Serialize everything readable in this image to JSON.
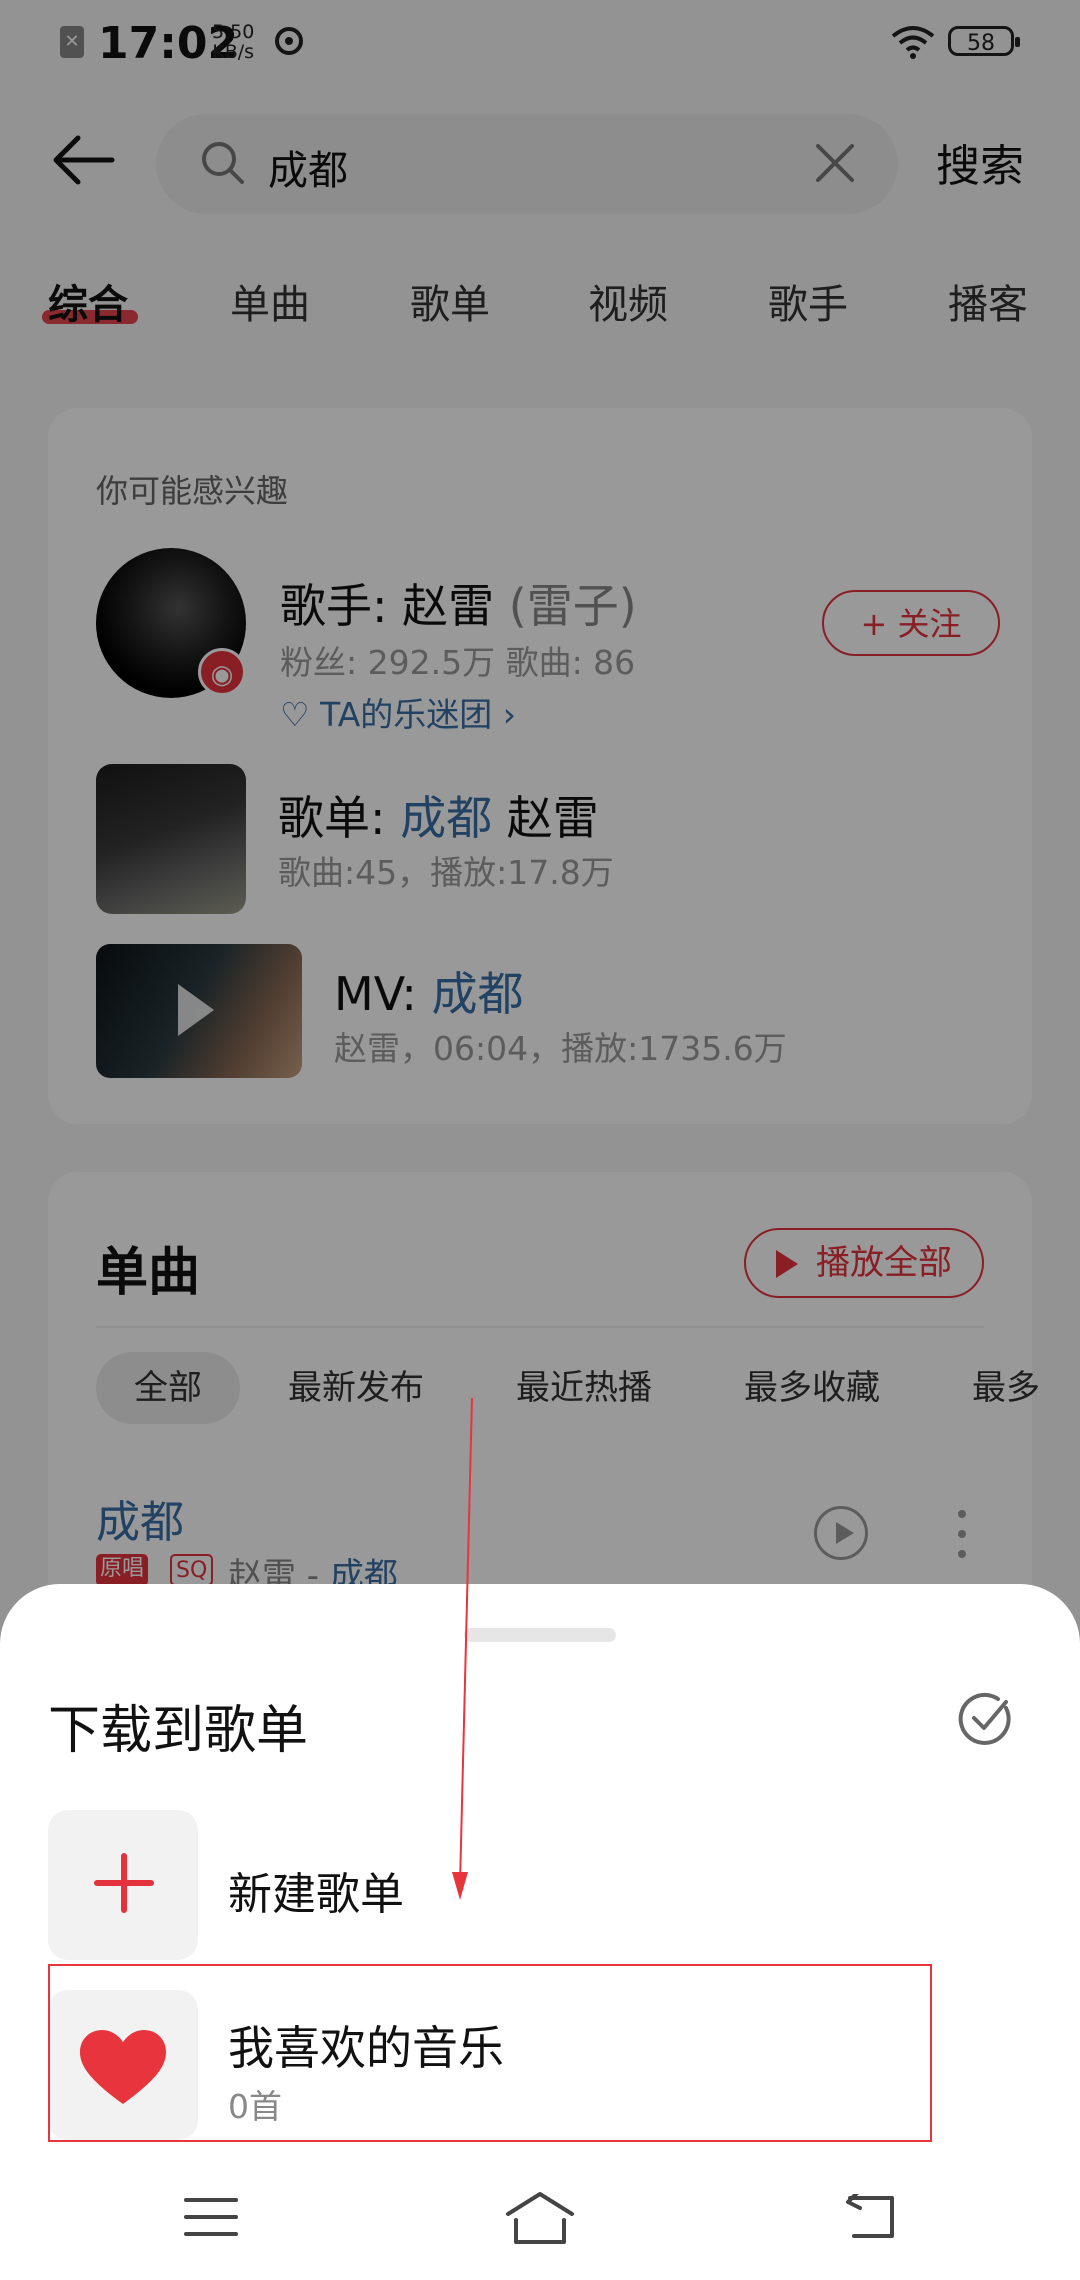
{
  "status_bar": {
    "time": "17:02",
    "net_speed_value": "5.50",
    "net_speed_unit": "KB/s",
    "battery": "58",
    "sim_icon": "sim-off-icon"
  },
  "search": {
    "query": "成都",
    "button_label": "搜索"
  },
  "tabs": [
    "综合",
    "单曲",
    "歌单",
    "视频",
    "歌手",
    "播客"
  ],
  "interest": {
    "title": "你可能感兴趣",
    "artist": {
      "prefix": "歌手: 赵雷",
      "alias": "(雷子)",
      "stats": "粉丝: 292.5万 歌曲: 86",
      "fan_club": "TA的乐迷团",
      "follow_label": "+ 关注"
    },
    "playlist": {
      "prefix": "歌单:",
      "keyword": "成都",
      "suffix": "赵雷",
      "stats": "歌曲:45，播放:17.8万"
    },
    "mv": {
      "prefix": "MV:",
      "keyword": "成都",
      "stats": "赵雷，06:04，播放:1735.6万"
    }
  },
  "songs": {
    "title": "单曲",
    "play_all_label": "播放全部",
    "chips": [
      "全部",
      "最新发布",
      "最近热播",
      "最多收藏",
      "最多"
    ],
    "first_song": {
      "title": "成都",
      "tag_original": "原唱",
      "tag_quality": "SQ",
      "artist": "赵雷 - ",
      "album": "成都"
    }
  },
  "sheet": {
    "title": "下载到歌单",
    "new_playlist_label": "新建歌单",
    "favorite_label": "我喜欢的音乐",
    "favorite_count": "0首"
  },
  "colors": {
    "accent": "#e4323c",
    "link": "#3a6ea5"
  }
}
